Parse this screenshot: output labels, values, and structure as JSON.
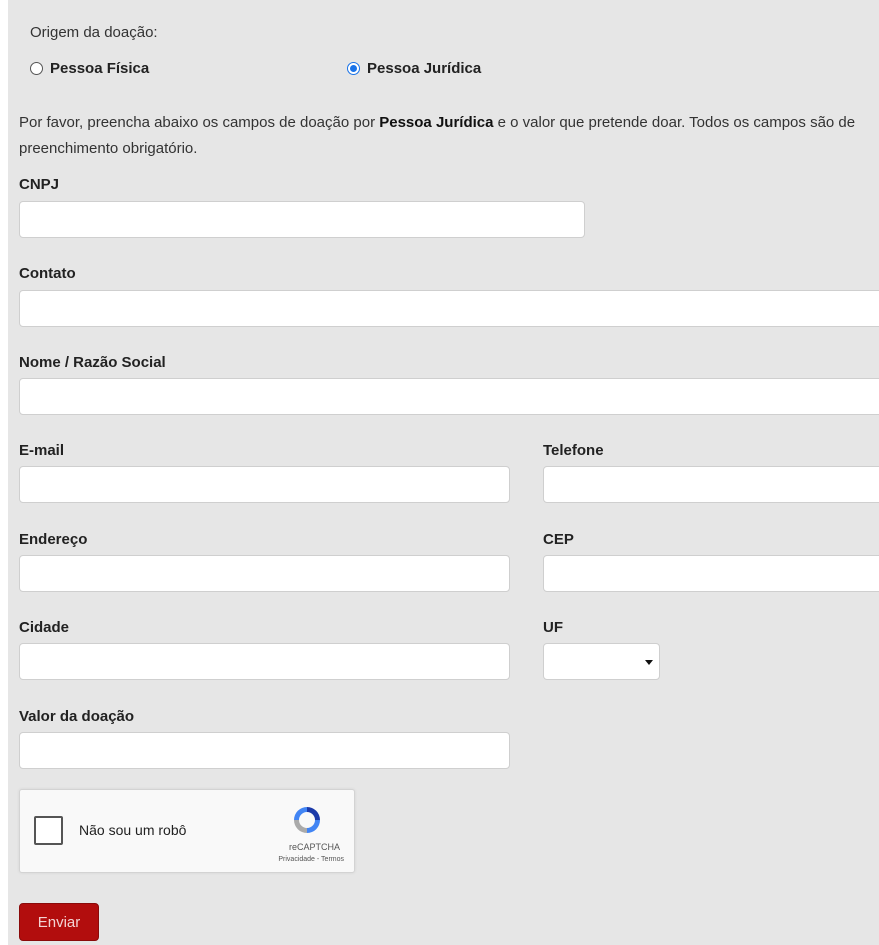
{
  "origin": {
    "label": "Origem da doação:",
    "options": [
      {
        "label": "Pessoa Física",
        "checked": false
      },
      {
        "label": "Pessoa Jurídica",
        "checked": true
      }
    ]
  },
  "intro": {
    "before": "Por favor, preencha abaixo os campos de doação por ",
    "bold": "Pessoa Jurídica",
    "after": " e o valor que pretende doar.   Todos os campos são de preenchimento obrigatório."
  },
  "fields": {
    "cnpj": {
      "label": "CNPJ",
      "value": ""
    },
    "contato": {
      "label": "Contato",
      "value": ""
    },
    "nome": {
      "label": "Nome / Razão Social",
      "value": ""
    },
    "email": {
      "label": "E-mail",
      "value": ""
    },
    "telefone": {
      "label": "Telefone",
      "value": ""
    },
    "endereco": {
      "label": "Endereço",
      "value": ""
    },
    "cep": {
      "label": "CEP",
      "value": ""
    },
    "cidade": {
      "label": "Cidade",
      "value": ""
    },
    "uf": {
      "label": "UF",
      "value": ""
    },
    "valor": {
      "label": "Valor da doação",
      "value": ""
    }
  },
  "captcha": {
    "checkbox_label": "Não sou um robô",
    "brand": "reCAPTCHA",
    "links": "Privacidade - Termos"
  },
  "submit_label": "Enviar",
  "colors": {
    "panel_bg": "#e6e6e6",
    "submit_bg": "#b20d0d",
    "radio_accent": "#1a73e8"
  }
}
